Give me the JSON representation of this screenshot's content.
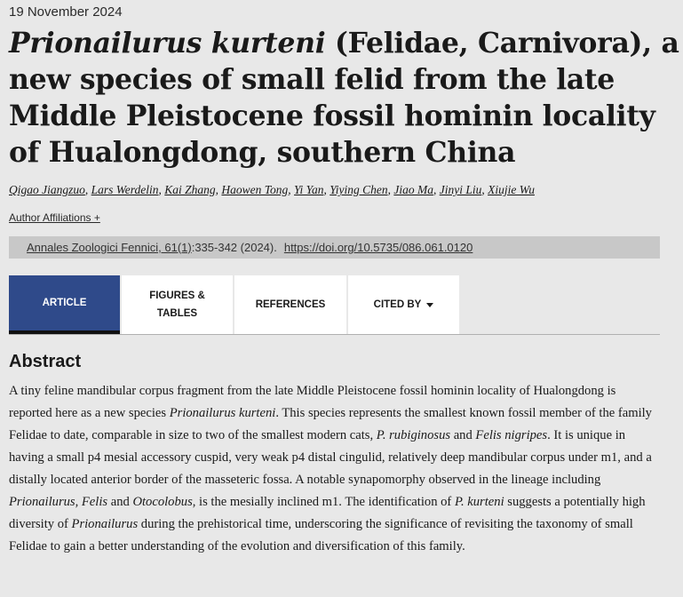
{
  "article": {
    "date": "19 November 2024",
    "title_italic": "Prionailurus kurteni",
    "title_rest": " (Felidae, Carnivora), a new species of small felid from the late Middle Pleistocene fossil hominin locality of Hualongdong, southern China",
    "authors": [
      "Qigao Jiangzuo",
      "Lars Werdelin",
      "Kai Zhang",
      "Haowen Tong",
      "Yi Yan",
      "Yiying Chen",
      "Jiao Ma",
      "Jinyi Liu",
      "Xiujie Wu"
    ],
    "author_separator": ", ",
    "author_affiliations_label": "Author Affiliations +",
    "citation": {
      "journal_link": "Annales Zoologici Fennici, 61(1)",
      "pages_year": ":335-342 (2024).",
      "doi": "https://doi.org/10.5735/086.061.0120"
    }
  },
  "tabs": [
    {
      "label": "ARTICLE",
      "active": true
    },
    {
      "label": "FIGURES & TABLES",
      "active": false
    },
    {
      "label": "REFERENCES",
      "active": false
    },
    {
      "label": "CITED BY",
      "active": false,
      "has_dropdown": true
    }
  ],
  "abstract": {
    "heading": "Abstract",
    "p1": "A tiny feline mandibular corpus fragment from the late Middle Pleistocene fossil hominin locality of Hualongdong is reported here as a new species ",
    "i1": "Prionailurus kurteni",
    "p2": ". This species represents the smallest known fossil member of the family Felidae to date, comparable in size to two of the smallest modern cats, ",
    "i2": "P. rubiginosus",
    "p3": " and ",
    "i3": "Felis nigripes",
    "p4": ". It is unique in having a small p4 mesial accessory cuspid, very weak p4 distal cingulid, relatively deep mandibular corpus under m1, and a distally located anterior border of the masseteric fossa. A notable synapomorphy observed in the lineage including ",
    "i4": "Prionailurus, Felis",
    "p5": " and ",
    "i5": "Otocolobus",
    "p6": ", is the mesially inclined m1. The identification of ",
    "i6": "P. kurteni",
    "p7": " suggests a potentially high diversity of ",
    "i7": "Prionailurus",
    "p8": " during the prehistorical time, underscoring the significance of revisiting the taxonomy of small Felidae to gain a better understanding of the evolution and diversification of this family."
  },
  "colors": {
    "background": "#e8e8e8",
    "active_tab": "#2f4a8a",
    "citation_bar": "#c8c8c8"
  }
}
